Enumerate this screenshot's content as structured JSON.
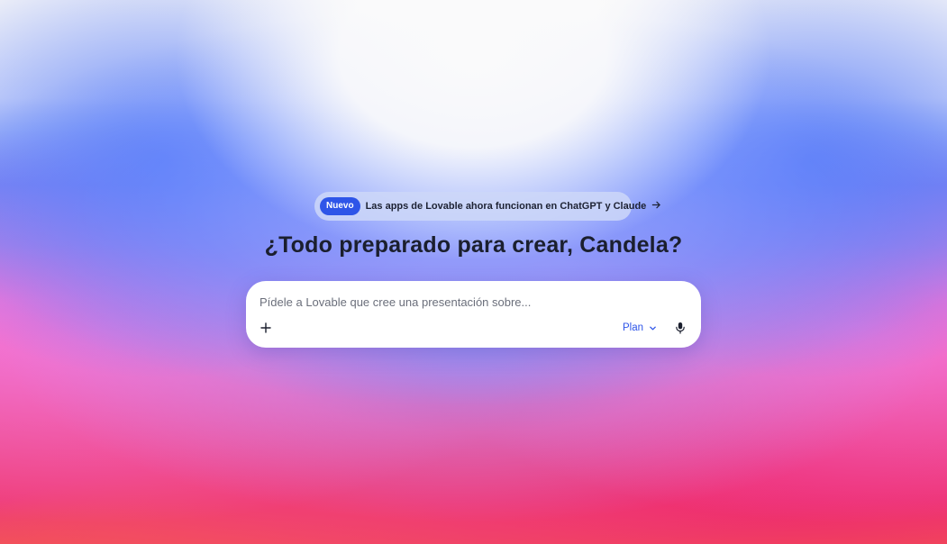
{
  "announcement": {
    "badge": "Nuevo",
    "text": "Las apps de Lovable ahora funcionan en ChatGPT y Claude",
    "icon": "arrow-right-icon"
  },
  "headline": "¿Todo preparado para crear, Candela?",
  "prompt": {
    "placeholder": "Pídele a Lovable que cree una presentación sobre...",
    "value": "",
    "attach_icon": "plus-icon",
    "mode_label": "Plan",
    "mode_icon": "chevron-down-icon",
    "voice_icon": "microphone-icon"
  },
  "colors": {
    "accent": "#2e55e8",
    "text": "#1b1f2e"
  }
}
